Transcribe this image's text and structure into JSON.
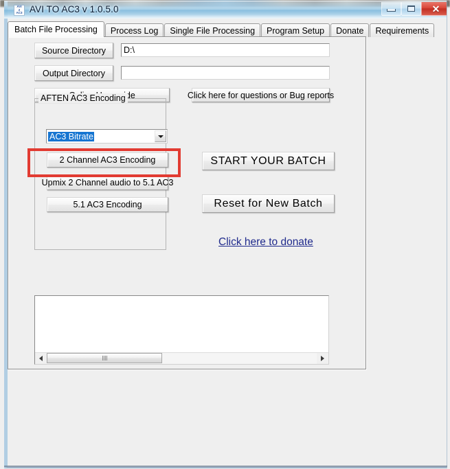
{
  "window": {
    "title": "AVI TO AC3 v 1.0.5.0",
    "icon_name": "avi-to-ac3-icon",
    "icon_lines": [
      "AVI",
      "2",
      "AC3"
    ],
    "controls": {
      "minimize": "Minimize",
      "maximize": "Maximize",
      "close": "✕"
    },
    "close_glyph": "✕"
  },
  "tabs": [
    {
      "label": "Batch File Processing",
      "active": true
    },
    {
      "label": "Process Log",
      "active": false
    },
    {
      "label": "Single File Processing",
      "active": false
    },
    {
      "label": "Program Setup",
      "active": false
    },
    {
      "label": "Donate",
      "active": false
    },
    {
      "label": "Requirements",
      "active": false
    }
  ],
  "batch_page": {
    "source_directory": {
      "button_label": "Source Directory",
      "value": "D:\\",
      "placeholder": ""
    },
    "output_directory": {
      "button_label": "Output Directory",
      "value": "",
      "placeholder": ""
    },
    "online_userguide_label": "Online Userguide",
    "bug_report_label": "Click here for questions or Bug reports",
    "group_aften": {
      "title": "AFTEN AC3 Encoding",
      "bitrate_combo": {
        "selected": "AC3 Bitrate",
        "arrow_icon": "chevron-down-icon"
      },
      "buttons": [
        "2 Channel AC3 Encoding",
        "Upmix 2 Channel audio to 5.1 AC3",
        "5.1 AC3 Encoding"
      ]
    },
    "start_batch_label": "START YOUR BATCH",
    "reset_batch_label": "Reset for New Batch",
    "donate_link_label": "Click here to donate",
    "log_listbox": {
      "items": [],
      "scroll_left_icon": "caret-left-icon",
      "scroll_right_icon": "caret-right-icon"
    }
  },
  "annotation": {
    "target": "2 Channel AC3 Encoding",
    "color": "#e23b32"
  },
  "colors": {
    "accent_blue": "#1675d1",
    "link_blue": "#1f2a8c",
    "face": "#efefef",
    "annotation_red": "#e23b32",
    "close_red": "#c22f23"
  }
}
